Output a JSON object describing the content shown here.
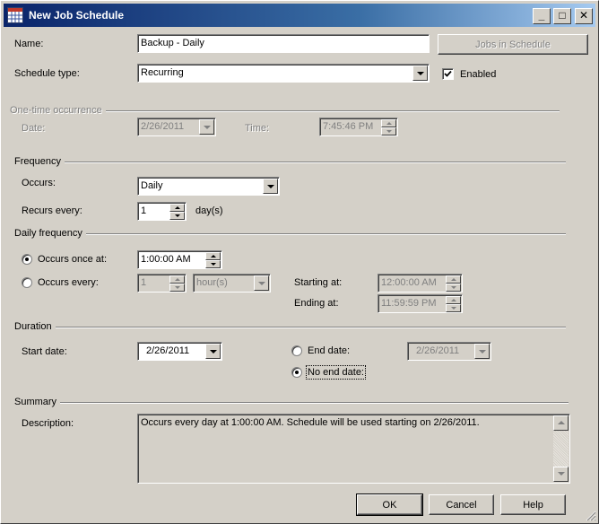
{
  "window": {
    "title": "New Job Schedule",
    "minimize": "_",
    "maximize": "□",
    "close": "✕"
  },
  "name": {
    "label": "Name:",
    "value": "Backup - Daily"
  },
  "jobs_in_schedule_button": "Jobs in Schedule",
  "schedule_type": {
    "label": "Schedule type:",
    "value": "Recurring"
  },
  "enabled": {
    "label": "Enabled",
    "checked": true
  },
  "one_time": {
    "title": "One-time occurrence",
    "date_label": "Date:",
    "date_value": "2/26/2011",
    "time_label": "Time:",
    "time_value": "7:45:46 PM"
  },
  "frequency": {
    "title": "Frequency",
    "occurs_label": "Occurs:",
    "occurs_value": "Daily",
    "recurs_label": "Recurs every:",
    "recurs_value": "1",
    "recurs_unit": "day(s)"
  },
  "daily_frequency": {
    "title": "Daily frequency",
    "once_label": "Occurs once at:",
    "once_value": "1:00:00 AM",
    "every_label": "Occurs every:",
    "every_value": "1",
    "every_unit": "hour(s)",
    "starting_label": "Starting at:",
    "starting_value": "12:00:00 AM",
    "ending_label": "Ending at:",
    "ending_value": "11:59:59 PM"
  },
  "duration": {
    "title": "Duration",
    "start_label": "Start date:",
    "start_value": "2/26/2011",
    "end_label": "End date:",
    "end_value": "2/26/2011",
    "no_end_label": "No end date:"
  },
  "summary": {
    "title": "Summary",
    "description_label": "Description:",
    "description_value": "Occurs every day at 1:00:00 AM. Schedule will be used starting on 2/26/2011."
  },
  "buttons": {
    "ok": "OK",
    "cancel": "Cancel",
    "help": "Help"
  }
}
